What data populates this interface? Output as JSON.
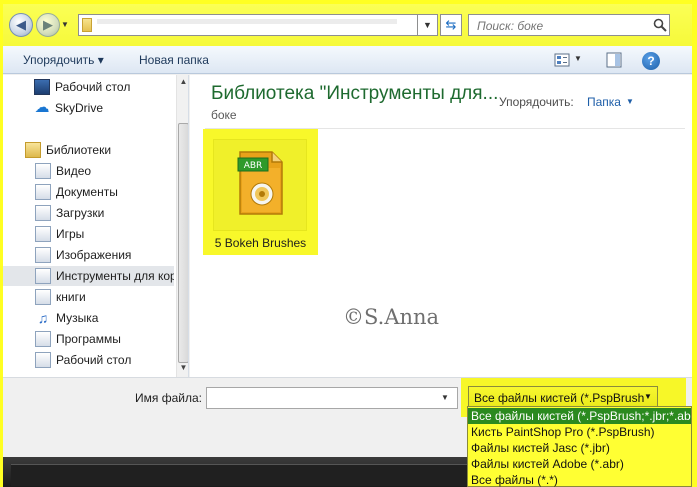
{
  "address": {
    "placeholder": ""
  },
  "search": {
    "placeholder": "Поиск: боке"
  },
  "toolbar": {
    "organize_label": "Упорядочить ▾",
    "new_folder_label": "Новая папка"
  },
  "nav": {
    "items": [
      {
        "label": "Рабочий стол",
        "icon": "desktop-icon"
      },
      {
        "label": "SkyDrive",
        "icon": "skydrive-icon"
      },
      {
        "label": "Библиотеки",
        "icon": "libraries-icon"
      },
      {
        "label": "Видео",
        "icon": "library-icon"
      },
      {
        "label": "Документы",
        "icon": "library-icon"
      },
      {
        "label": "Загрузки",
        "icon": "library-icon"
      },
      {
        "label": "Игры",
        "icon": "library-icon"
      },
      {
        "label": "Изображения",
        "icon": "library-icon"
      },
      {
        "label": "Инструменты для кор",
        "icon": "library-icon"
      },
      {
        "label": "книги",
        "icon": "library-icon"
      },
      {
        "label": "Музыка",
        "icon": "music-icon"
      },
      {
        "label": "Программы",
        "icon": "library-icon"
      },
      {
        "label": "Рабочий стол",
        "icon": "library-icon"
      }
    ]
  },
  "content": {
    "title": "Библиотека \"Инструменты для...",
    "subtitle": "боке",
    "arrange_label": "Упорядочить:",
    "arrange_value": "Папка",
    "file": {
      "name": "5 Bokeh Brushes",
      "badge": "ABR"
    },
    "watermark": "©S.Anna"
  },
  "bottom": {
    "filename_label": "Имя файла:",
    "filename_value": "",
    "filter_selected": "Все файлы кистей (*.PspBrush",
    "filter_options": [
      "Все файлы кистей (*.PspBrush;*.jbr;*.abr)",
      "Кисть PaintShop Pro (*.PspBrush)",
      "Файлы кистей Jasc (*.jbr)",
      "Файлы кистей Adobe (*.abr)",
      "Все файлы (*.*)"
    ]
  },
  "colors": {
    "highlight": "#ffff33",
    "selected_option": "#2b8a1f",
    "title_green": "#1e6a2f",
    "link_blue": "#1e5ea8"
  }
}
